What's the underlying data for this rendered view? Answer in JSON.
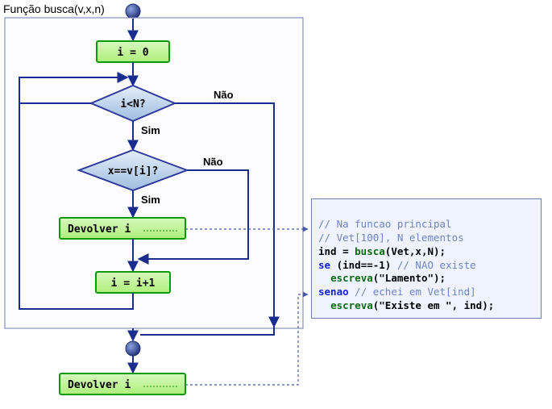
{
  "title": "Função busca(v,x,n)",
  "nodes": {
    "init": {
      "label": "i = 0"
    },
    "cond1": {
      "label": "i<N?"
    },
    "cond2": {
      "label": "x==v[i]?"
    },
    "return1": {
      "label": "Devolver i"
    },
    "inc": {
      "label": "i = i+1"
    },
    "return2": {
      "label": "Devolver i"
    }
  },
  "labels": {
    "yes": "Sim",
    "no": "Não"
  },
  "code": {
    "l1": "// Na funcao principal",
    "l2": "// Vet[100], N elementos",
    "l3a": "ind = ",
    "l3b": "busca",
    "l3c": "(Vet,x,N);",
    "l4a": "se",
    "l4b": " (ind==-1) ",
    "l4c": "// NAO existe",
    "l5a": "escreva",
    "l5b": "(\"Lamento\");",
    "l6a": "senao",
    "l6b": " ",
    "l6c": "// echei em Vet[ind]",
    "l7a": "escreva",
    "l7b": "(\"Existe em \", ind);"
  },
  "colors": {
    "frame": "#6c7db0",
    "greenFillTop": "#d7f8bf",
    "greenFillBot": "#aef07a",
    "greenStroke": "#0c9a0c",
    "blueFillTop": "#dce8f8",
    "blueFillBot": "#9fbde0",
    "blueStroke": "#2f3a9c",
    "arrow": "#1a2d8f",
    "dot": "#2f3a9c",
    "dotted": "#4a5aa0"
  }
}
